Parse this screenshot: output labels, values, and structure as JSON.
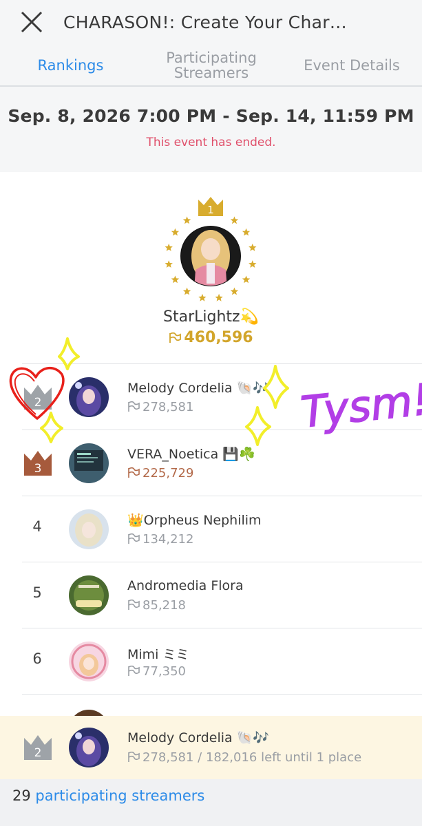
{
  "header": {
    "title": "CHARASON!: Create Your Char…"
  },
  "tabs": [
    {
      "label": "Rankings",
      "active": true
    },
    {
      "label": "Participating Streamers",
      "active": false
    },
    {
      "label": "Event Details",
      "active": false
    }
  ],
  "event": {
    "period": "Sep. 8, 2026 7:00 PM - Sep. 14, 11:59 PM",
    "status": "This event has ended."
  },
  "winner": {
    "rank": "1",
    "name": "StarLightz💫",
    "score": "460,596"
  },
  "rankings": [
    {
      "rank": "2",
      "name": "Melody Cordelia 🐚🎶",
      "score": "278,581"
    },
    {
      "rank": "3",
      "name": "VERA_Noetica 💾☘️",
      "score": "225,729"
    },
    {
      "rank": "4",
      "name": "👑Orpheus Nephilim",
      "score": "134,212"
    },
    {
      "rank": "5",
      "name": "Andromedia Flora",
      "score": "85,218"
    },
    {
      "rank": "6",
      "name": "Mimi ミミ",
      "score": "77,350"
    }
  ],
  "current": {
    "rank": "2",
    "name": "Melody Cordelia 🐚🎶",
    "score": "278,581 / 182,016 left until 1 place"
  },
  "footer": {
    "count": "29",
    "link": "participating streamers"
  },
  "annotation": {
    "text": "Tysm!"
  },
  "colors": {
    "accent": "#2c8be8",
    "gold": "#d2a52b",
    "silver": "#9ea3a8",
    "bronze": "#a65a3c",
    "ended": "#e0506b",
    "doodle_purple": "#b23ee6",
    "doodle_yellow": "#f2ee2a",
    "doodle_red": "#e8201a"
  }
}
